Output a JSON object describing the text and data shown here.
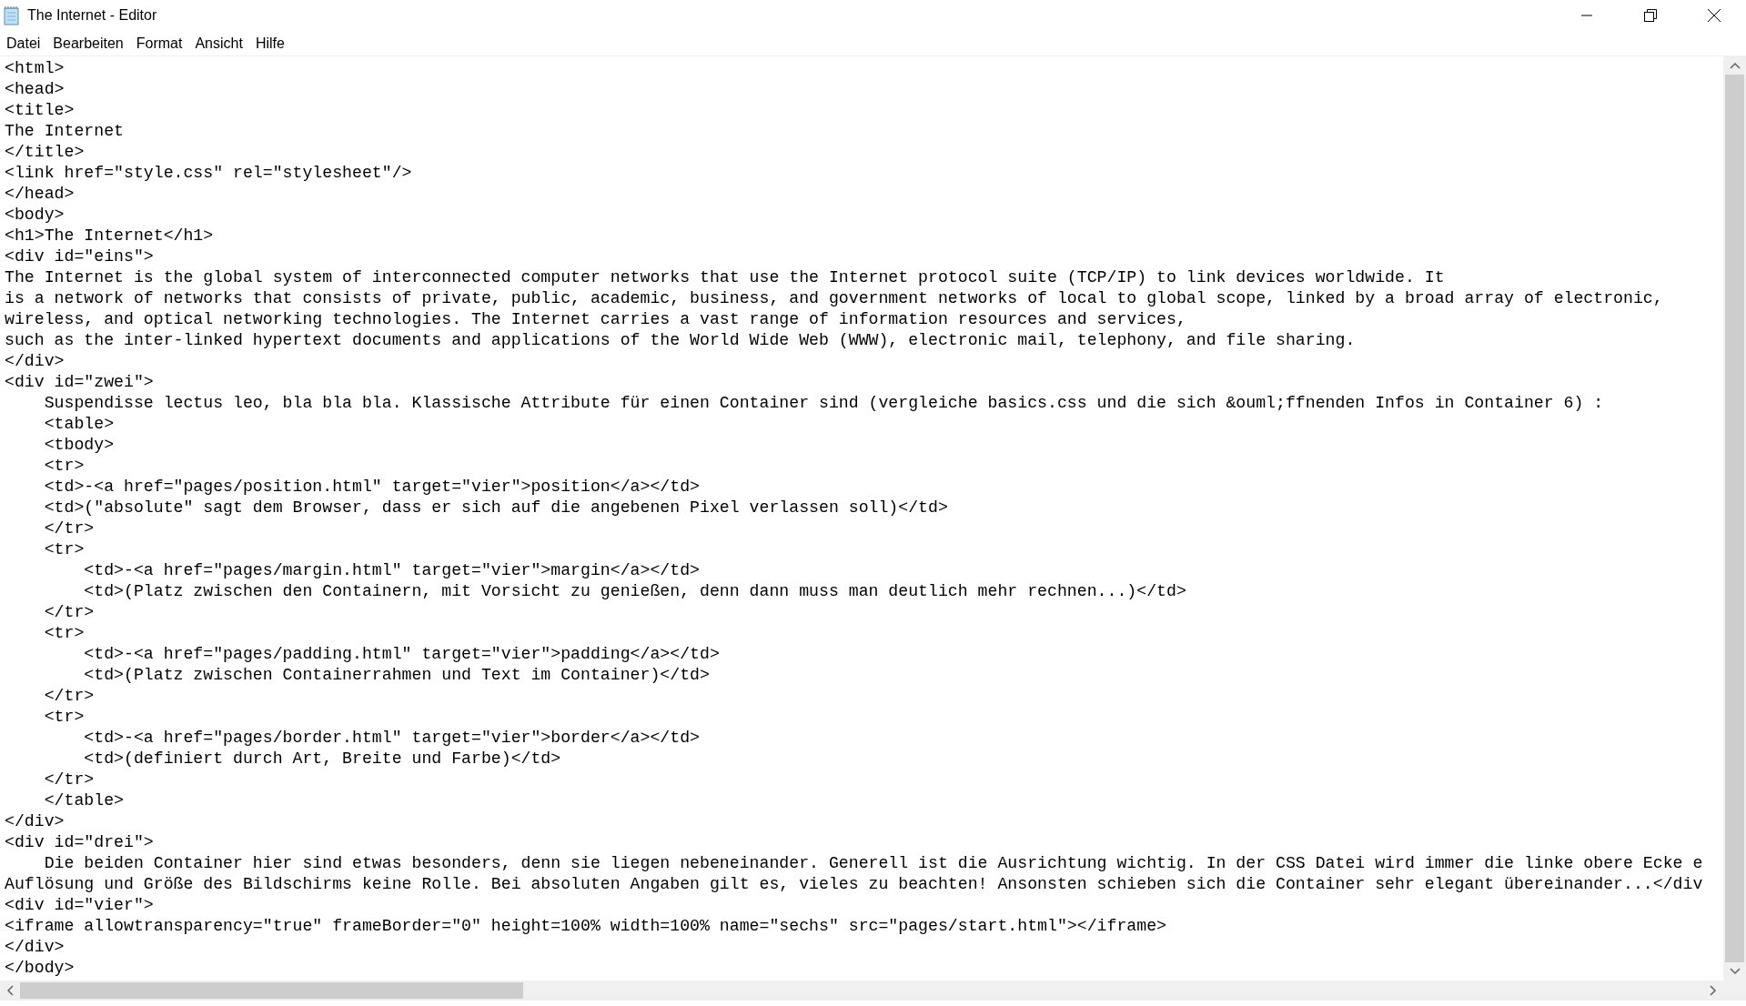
{
  "window": {
    "title": "The Internet - Editor"
  },
  "menu": [
    "Datei",
    "Bearbeiten",
    "Format",
    "Ansicht",
    "Hilfe"
  ],
  "lines": [
    "<html>",
    "<head>",
    "<title>",
    "The Internet",
    "</title>",
    "<link href=\"style.css\" rel=\"stylesheet\"/>",
    "</head>",
    "<body>",
    "<h1>The Internet</h1>",
    "<div id=\"eins\">",
    "The Internet is the global system of interconnected computer networks that use the Internet protocol suite (TCP/IP) to link devices worldwide. It",
    "is a network of networks that consists of private, public, academic, business, and government networks of local to global scope, linked by a broad array of electronic,",
    "wireless, and optical networking technologies. The Internet carries a vast range of information resources and services,",
    "such as the inter-linked hypertext documents and applications of the World Wide Web (WWW), electronic mail, telephony, and file sharing.",
    "</div>",
    "<div id=\"zwei\">",
    "    Suspendisse lectus leo, bla bla bla. Klassische Attribute für einen Container sind (vergleiche basics.css und die sich &ouml;ffnenden Infos in Container 6) :",
    "    <table>",
    "    <tbody>",
    "    <tr>",
    "    <td>-<a href=\"pages/position.html\" target=\"vier\">position</a></td>",
    "    <td>(\"absolute\" sagt dem Browser, dass er sich auf die angebenen Pixel verlassen soll)</td>",
    "    </tr>",
    "    <tr>",
    "        <td>-<a href=\"pages/margin.html\" target=\"vier\">margin</a></td>",
    "        <td>(Platz zwischen den Containern, mit Vorsicht zu genießen, denn dann muss man deutlich mehr rechnen...)</td>",
    "    </tr>",
    "    <tr>",
    "        <td>-<a href=\"pages/padding.html\" target=\"vier\">padding</a></td>",
    "        <td>(Platz zwischen Containerrahmen und Text im Container)</td>",
    "    </tr>",
    "    <tr>",
    "        <td>-<a href=\"pages/border.html\" target=\"vier\">border</a></td>",
    "        <td>(definiert durch Art, Breite und Farbe)</td>",
    "    </tr>",
    "    </table>",
    "</div>",
    "<div id=\"drei\">",
    "    Die beiden Container hier sind etwas besonders, denn sie liegen nebeneinander. Generell ist die Ausrichtung wichtig. In der CSS Datei wird immer die linke obere Ecke e",
    "Auflösung und Größe des Bildschirms keine Rolle. Bei absoluten Angaben gilt es, vieles zu beachten! Ansonsten schieben sich die Container sehr elegant übereinander...</div",
    "<div id=\"vier\">",
    "<iframe allowtransparency=\"true\" frameBorder=\"0\" height=100% width=100% name=\"sechs\" src=\"pages/start.html\"></iframe>",
    "</div>",
    "</body>"
  ]
}
